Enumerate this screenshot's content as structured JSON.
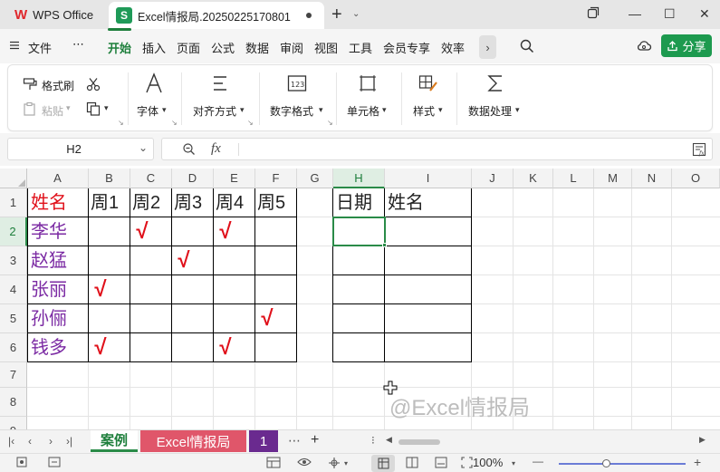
{
  "titlebar": {
    "home_tab": "WPS Office",
    "doc_badge": "S",
    "doc_title": "Excel情报局.20250225170801",
    "new_tab": "+",
    "minimize": "—",
    "maximize": "☐",
    "close": "✕"
  },
  "menubar": {
    "file": "文件",
    "more": "⋯",
    "tabs": [
      "开始",
      "插入",
      "页面",
      "公式",
      "数据",
      "审阅",
      "视图",
      "工具",
      "会员专享",
      "效率"
    ],
    "share": "分享"
  },
  "ribbon": {
    "format_painter": "格式刷",
    "paste": "粘贴",
    "font": "字体",
    "align": "对齐方式",
    "number_format": "数字格式",
    "cells": "单元格",
    "styles": "样式",
    "data_processing": "数据处理"
  },
  "formulabar": {
    "name_box": "H2",
    "fx": "fx",
    "content": ""
  },
  "grid": {
    "columns": [
      "A",
      "B",
      "C",
      "D",
      "E",
      "F",
      "G",
      "H",
      "I",
      "J",
      "K",
      "L",
      "M",
      "N",
      "O"
    ],
    "rows": [
      "1",
      "2",
      "3",
      "4",
      "5",
      "6",
      "7",
      "8",
      "9"
    ],
    "selected_cell": "H2",
    "header_row": [
      "姓名",
      "周1",
      "周2",
      "周3",
      "周4",
      "周5"
    ],
    "names": [
      "李华",
      "赵猛",
      "张丽",
      "孙俪",
      "钱多"
    ],
    "check_mark": "√",
    "checks": [
      [
        0,
        1
      ],
      [
        0,
        3
      ],
      [
        1,
        2
      ],
      [
        2,
        0
      ],
      [
        3,
        4
      ],
      [
        4,
        0
      ],
      [
        4,
        3
      ]
    ],
    "right_table_headers": [
      "日期",
      "姓名"
    ],
    "watermark": "@Excel情报局",
    "colors": {
      "name_header": "#e0101a",
      "names": "#7b2aa3",
      "check": "#e0101a"
    }
  },
  "sheets": {
    "tabs": [
      "案例",
      "Excel情报局",
      "1"
    ],
    "active": "案例",
    "more": "⋯",
    "add": "+"
  },
  "statusbar": {
    "zoom": "100%",
    "zoom_minus": "—",
    "zoom_plus": "+"
  }
}
